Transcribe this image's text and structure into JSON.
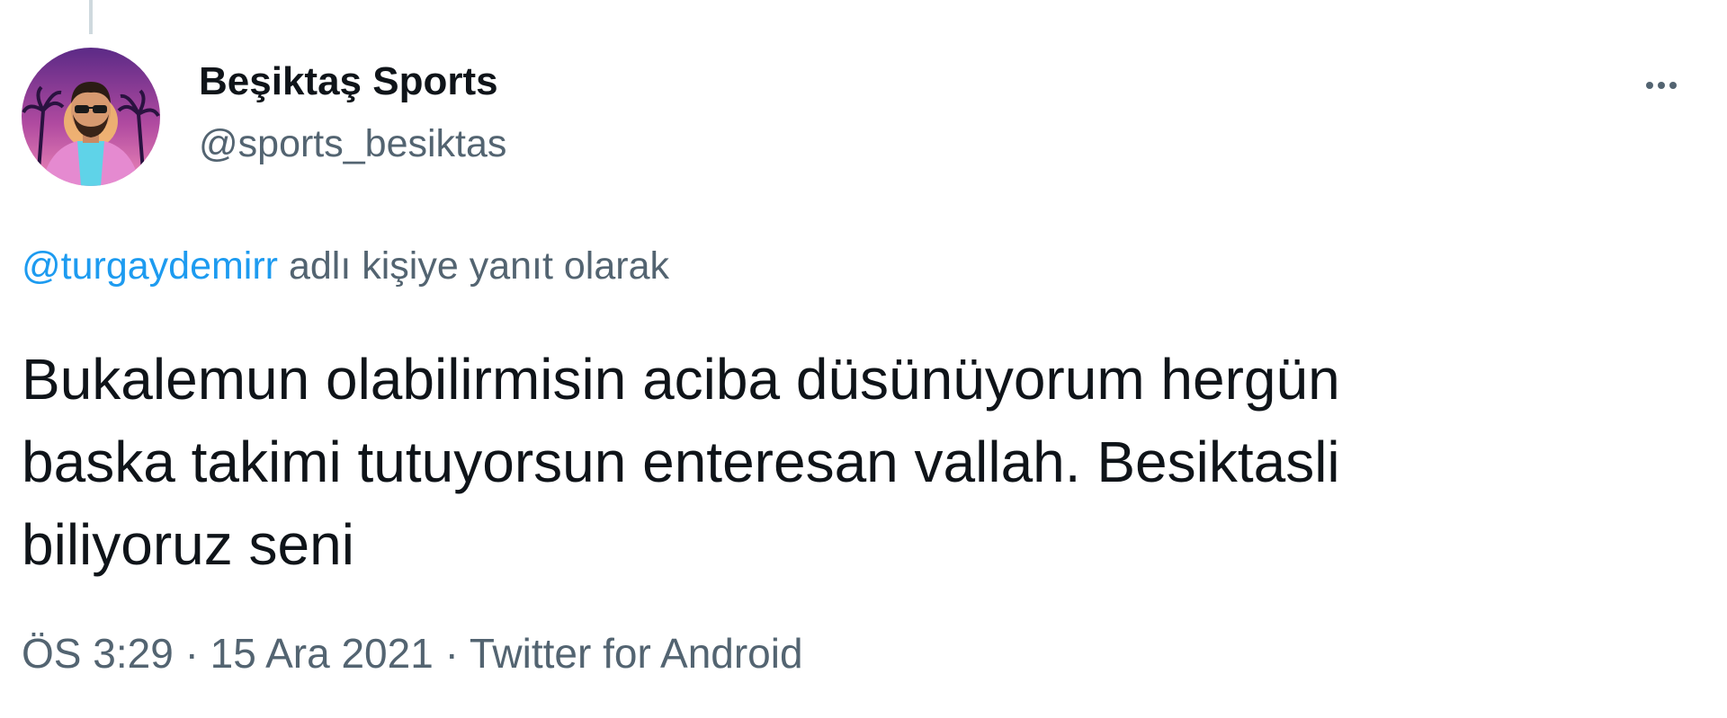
{
  "tweet": {
    "author": {
      "display_name": "Beşiktaş Sports",
      "handle": "@sports_besiktas",
      "avatar_icon": "avatar-illustration"
    },
    "more_icon": "more-horizontal-icon",
    "reply_context": {
      "mention": "@turgaydemirr",
      "text": "adlı kişiye yanıt olarak"
    },
    "body_lines": [
      "Bukalemun olabilirmisin aciba düsünüyorum hergün",
      "baska takimi tutuyorsun enteresan vallah. Besiktasli",
      "biliyoruz seni"
    ],
    "time": "ÖS 3:29",
    "separator": "·",
    "date": "15 Ara 2021",
    "source": "Twitter for Android"
  },
  "colors": {
    "accent": "#1d9bf0",
    "text_primary": "#0f1419",
    "text_secondary": "#536471"
  }
}
